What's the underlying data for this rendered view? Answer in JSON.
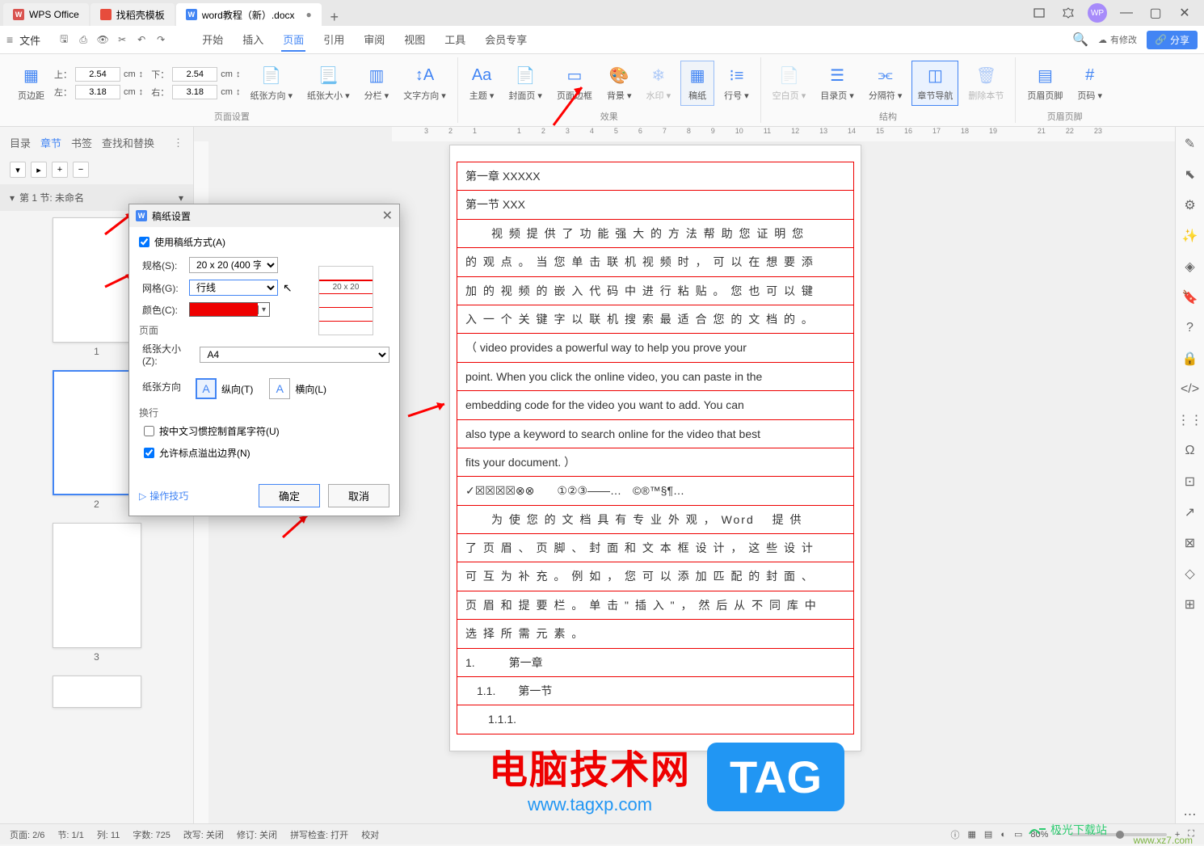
{
  "tabs": [
    {
      "label": "WPS Office",
      "iconText": "W"
    },
    {
      "label": "找稻壳模板",
      "iconText": ""
    },
    {
      "label": "word教程（新）.docx",
      "iconText": "W",
      "modified": "●"
    }
  ],
  "menu": {
    "file": "文件",
    "ribbon": [
      "开始",
      "插入",
      "页面",
      "引用",
      "审阅",
      "视图",
      "工具",
      "会员专享"
    ],
    "activeIndex": 2,
    "modify": "有修改",
    "share": "分享"
  },
  "ribbon": {
    "pageMargin": "页边距",
    "top": "上：",
    "topVal": "2.54",
    "bottom": "下：",
    "bottomVal": "2.54",
    "left": "左：",
    "leftVal": "3.18",
    "right": "右：",
    "rightVal": "3.18",
    "unit": "cm",
    "paperDir": "纸张方向",
    "paperSize": "纸张大小",
    "columns": "分栏",
    "textDir": "文字方向",
    "groupPage": "页面设置",
    "theme": "主题",
    "cover": "封面页",
    "pageBorder": "页面边框",
    "background": "背景",
    "watermark": "水印",
    "gaozhi": "稿纸",
    "lineNum": "行号",
    "groupEffect": "效果",
    "blankPage": "空白页",
    "indexPage": "目录页",
    "separator": "分隔符",
    "chapterNav": "章节导航",
    "deleteSection": "删除本节",
    "groupStructure": "结构",
    "headerFooter": "页眉页脚",
    "pageNum": "页码",
    "groupHF": "页眉页脚"
  },
  "leftPanel": {
    "tabs": [
      "目录",
      "章节",
      "书签",
      "查找和替换"
    ],
    "activeIndex": 1,
    "controls": [
      "▾",
      "▸",
      "+",
      "−"
    ],
    "section": "第 1 节: 未命名",
    "thumbLabels": [
      "1",
      "2",
      "3"
    ]
  },
  "rulerMarks": [
    "3",
    "2",
    "1",
    "",
    "1",
    "2",
    "3",
    "4",
    "5",
    "6",
    "7",
    "8",
    "9",
    "10",
    "11",
    "12",
    "13",
    "14",
    "15",
    "16",
    "17",
    "18",
    "19",
    "",
    "21",
    "22",
    "23"
  ],
  "document": {
    "chapter": "第一章  XXXXX",
    "section": "第一节  XXX",
    "lines": [
      "　　视 频 提 供 了 功 能 强 大 的 方 法 帮 助 您 证 明 您",
      "的 观 点 。 当 您 单 击 联 机 视 频 时 ， 可 以 在 想 要 添",
      "加 的 视 频 的 嵌 入 代 码 中 进 行 粘 贴 。 您 也 可 以 键",
      "入 一 个 关 键 字 以 联 机 搜 索 最 适 合 您 的 文 档 的 。",
      "（  video provides a powerful way to help you prove your",
      "point. When you click the online video, you can paste in the",
      "embedding code for the video you want to add. You can",
      "also type a keyword to search online for the video that best",
      "fits your document.  ）",
      "✓☒☒☒☒⊗⊗　　①②③——…　©®™§¶…",
      "　　为 使 您 的 文 档 具 有 专 业 外 观 ，  Word 　提 供",
      "了 页 眉 、 页 脚 、 封 面 和 文 本 框 设 计 ， 这 些 设 计",
      "可 互 为 补 充 。 例 如 ， 您 可 以 添 加 匹 配 的 封 面 、",
      "页 眉 和 提 要 栏 。 单 击 \" 插 入 \" ， 然 后 从 不 同 库 中",
      "选 择 所 需 元 素 。",
      "1.　　　第一章",
      "　1.1.　　第一节",
      "　　1.1.1."
    ]
  },
  "dialog": {
    "title": "稿纸设置",
    "useGrid": "使用稿纸方式(A)",
    "spec": "规格(S):",
    "specVal": "20 x 20 (400 字)",
    "grid": "网格(G):",
    "gridVal": "行线",
    "color": "颜色(C):",
    "previewLabel": "20 x 20",
    "pageSection": "页面",
    "paperSize": "纸张大小(Z):",
    "paperSizeVal": "A4",
    "paperDir": "纸张方向",
    "portrait": "纵向(T)",
    "landscape": "横向(L)",
    "wrapSection": "换行",
    "cjkRule": "按中文习惯控制首尾字符(U)",
    "punctOverflow": "允许标点溢出边界(N)",
    "tips": "操作技巧",
    "ok": "确定",
    "cancel": "取消"
  },
  "status": {
    "page": "页面: 2/6",
    "section": "节: 1/1",
    "column": "列: 11",
    "wordCount": "字数: 725",
    "rewrite": "改写: 关闭",
    "revision": "修订: 关闭",
    "spellCheck": "拼写检查: 打开",
    "proof": "校对",
    "zoom": "80%"
  },
  "watermark": {
    "title": "电脑技术网",
    "url": "www.tagxp.com",
    "tag": "TAG",
    "dlSite": "极光下载站",
    "dlUrl": "www.xz7.com"
  }
}
